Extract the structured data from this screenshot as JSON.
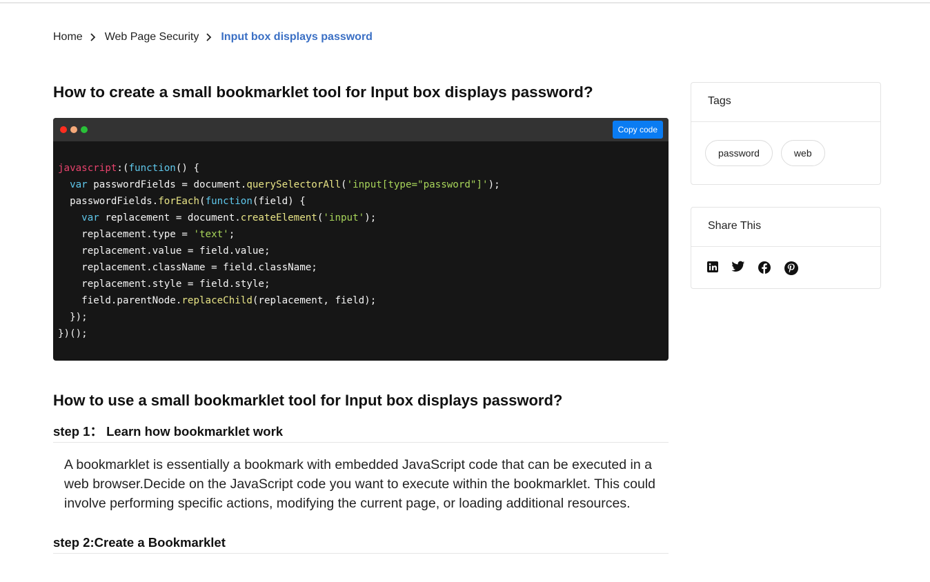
{
  "breadcrumb": {
    "home": "Home",
    "category": "Web Page Security",
    "current": "Input box displays password"
  },
  "main": {
    "title": "How to create a small bookmarklet tool for Input box displays password?",
    "code_box": {
      "copy_label": "Copy code",
      "dot_colors": [
        "#ff2d1f",
        "#f5a97a",
        "#29c138"
      ]
    },
    "usage_title": "How to use a small bookmarklet tool for Input box displays password?",
    "steps": [
      {
        "heading": "step 1： Learn how bookmarklet work",
        "body": "A bookmarklet is essentially a bookmark with embedded JavaScript code that can be executed in a web browser.Decide on the JavaScript code you want to execute within the bookmarklet. This could involve performing specific actions, modifying the current page, or loading additional resources."
      },
      {
        "heading": "step 2:Create a Bookmarklet"
      }
    ]
  },
  "sidebar": {
    "tags_card": {
      "title": "Tags",
      "tags": [
        "password",
        "web"
      ]
    },
    "share_card": {
      "title": "Share This",
      "icons": [
        "linkedin-icon",
        "twitter-icon",
        "facebook-icon",
        "pinterest-icon"
      ]
    }
  },
  "colors": {
    "accent": "#3a6fc4",
    "copy_button": "#0a7cf3",
    "code_bg": "#161616",
    "code_bar": "#333333"
  }
}
